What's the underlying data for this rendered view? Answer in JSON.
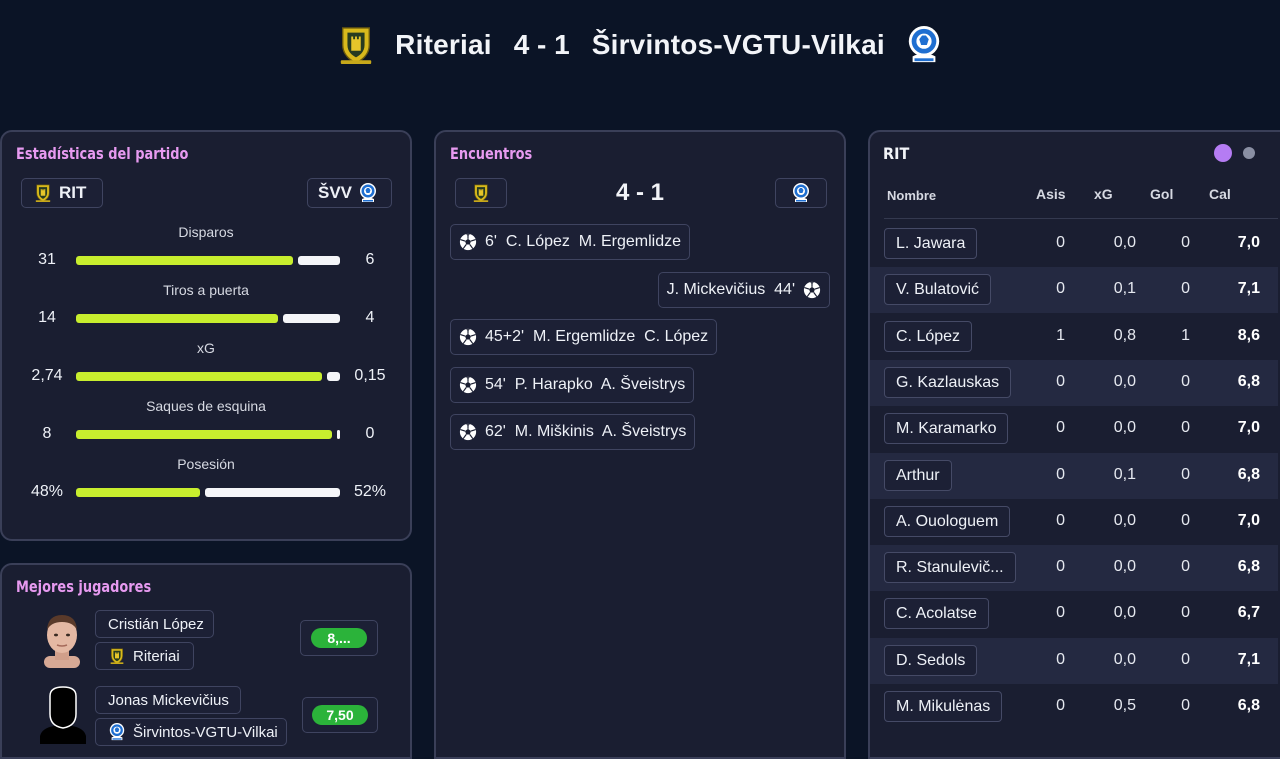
{
  "header": {
    "home_team": "Riteriai",
    "score": "4 - 1",
    "away_team": "Širvintos-VGTU-Vilkai"
  },
  "stats_panel": {
    "title": "Estadísticas del partido",
    "home_abbr": "RIT",
    "away_abbr": "ŠVV",
    "stats": [
      {
        "label": "Disparos",
        "home": "31",
        "away": "6",
        "home_share": 0.838
      },
      {
        "label": "Tiros a puerta",
        "home": "14",
        "away": "4",
        "home_share": 0.778
      },
      {
        "label": "xG",
        "home": "2,74",
        "away": "0,15",
        "home_share": 0.948
      },
      {
        "label": "Saques de esquina",
        "home": "8",
        "away": "0",
        "home_share": 1.0
      },
      {
        "label": "Posesión",
        "home": "48%",
        "away": "52%",
        "home_share": 0.48
      }
    ]
  },
  "best_players": {
    "title": "Mejores jugadores",
    "players": [
      {
        "name": "Cristián López",
        "team": "Riteriai",
        "rating": "8,..."
      },
      {
        "name": "Jonas Mickevičius",
        "team": "Širvintos-VGTU-Vilkai",
        "rating": "7,50"
      }
    ]
  },
  "events_panel": {
    "title": "Encuentros",
    "score": "4 - 1",
    "events": [
      {
        "text": "6'  C. López  M. Ergemlidze",
        "side": "home"
      },
      {
        "text": "J. Mickevičius  44'",
        "side": "away"
      },
      {
        "text": "45+2'  M. Ergemlidze  C. López",
        "side": "home"
      },
      {
        "text": "54'  P. Harapko  A. Šveistrys",
        "side": "home"
      },
      {
        "text": "62'  M. Miškinis  A. Šveistrys",
        "side": "home"
      }
    ]
  },
  "lineup_panel": {
    "title": "RIT",
    "columns": {
      "name": "Nombre",
      "ast": "Asis",
      "xg": "xG",
      "goals": "Gol",
      "rating": "Cal"
    },
    "page_dots": {
      "active_color": "#b57cf3",
      "inactive_color": "#8a8fa3"
    },
    "players": [
      {
        "name": "L. Jawara",
        "ast": "0",
        "xg": "0,0",
        "goals": "0",
        "rating": "7,0"
      },
      {
        "name": "V. Bulatović",
        "ast": "0",
        "xg": "0,1",
        "goals": "0",
        "rating": "7,1"
      },
      {
        "name": "C. López",
        "ast": "1",
        "xg": "0,8",
        "goals": "1",
        "rating": "8,6"
      },
      {
        "name": "G. Kazlauskas",
        "ast": "0",
        "xg": "0,0",
        "goals": "0",
        "rating": "6,8"
      },
      {
        "name": "M. Karamarko",
        "ast": "0",
        "xg": "0,0",
        "goals": "0",
        "rating": "7,0"
      },
      {
        "name": "Arthur",
        "ast": "0",
        "xg": "0,1",
        "goals": "0",
        "rating": "6,8"
      },
      {
        "name": "A. Ouologuem",
        "ast": "0",
        "xg": "0,0",
        "goals": "0",
        "rating": "7,0"
      },
      {
        "name": "R. Stanulevič...",
        "ast": "0",
        "xg": "0,0",
        "goals": "0",
        "rating": "6,8"
      },
      {
        "name": "C. Acolatse",
        "ast": "0",
        "xg": "0,0",
        "goals": "0",
        "rating": "6,7"
      },
      {
        "name": "D. Sedols",
        "ast": "0",
        "xg": "0,0",
        "goals": "0",
        "rating": "7,1"
      },
      {
        "name": "M. Mikulėnas",
        "ast": "0",
        "xg": "0,5",
        "goals": "0",
        "rating": "6,8"
      }
    ]
  },
  "colors": {
    "accent_title": "#e79af0",
    "bar_home": "#c8ee2e",
    "bar_away": "#f4f5f8",
    "rating_green": "#2bb33a"
  },
  "icons": {
    "home_crest": "riteriai-crest-icon",
    "away_crest": "svv-crest-icon",
    "goal": "soccer-ball-icon"
  }
}
